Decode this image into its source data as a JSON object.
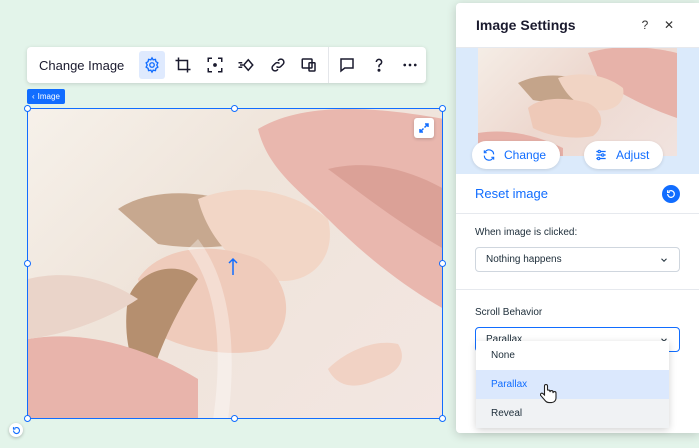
{
  "toolbar": {
    "change_image_label": "Change Image",
    "buttons": [
      {
        "icon": "gear-icon"
      },
      {
        "icon": "crop-icon"
      },
      {
        "icon": "focal-point-icon"
      },
      {
        "icon": "animation-icon"
      },
      {
        "icon": "link-icon"
      },
      {
        "icon": "stretch-icon"
      },
      {
        "icon": "comment-icon"
      },
      {
        "icon": "help-icon"
      },
      {
        "icon": "more-icon"
      }
    ]
  },
  "image_tag": "Image",
  "panel": {
    "title": "Image Settings",
    "help": "?",
    "close": "✕",
    "change_label": "Change",
    "adjust_label": "Adjust",
    "reset_label": "Reset image",
    "click_label": "When image is clicked:",
    "click_value": "Nothing happens",
    "scroll_label": "Scroll Behavior",
    "scroll_value": "Parallax"
  },
  "dropdown": {
    "options": [
      "None",
      "Parallax",
      "Reveal"
    ],
    "selected": "Parallax"
  },
  "colors": {
    "accent": "#116dff",
    "canvas_bg": "#e3f4ea"
  }
}
